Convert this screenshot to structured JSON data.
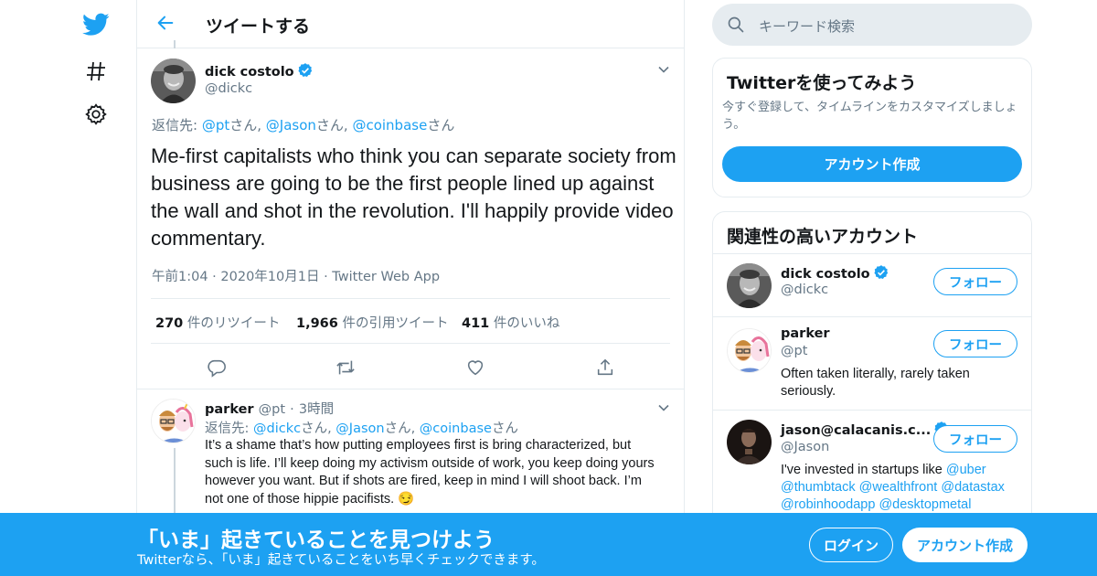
{
  "colors": {
    "accent": "#1da1f2",
    "border": "#e6ecf0",
    "secondary_text": "#657786",
    "primary_text": "#14171a"
  },
  "nav": {
    "icons": [
      "twitter-logo-icon",
      "hashtag-icon",
      "gear-icon"
    ]
  },
  "header": {
    "title": "ツイートする",
    "back_icon": "arrow-left-icon"
  },
  "tweet": {
    "author_name": "dick costolo",
    "author_handle": "@dickc",
    "verified": true,
    "reply_prefix": "返信先: ",
    "reply_to": [
      {
        "handle": "@pt",
        "suffix": "さん, "
      },
      {
        "handle": "@Jason",
        "suffix": "さん, "
      },
      {
        "handle": "@coinbase",
        "suffix": "さん"
      }
    ],
    "text": "Me-first capitalists who think you can separate society from business are going to be the first people lined up against the wall and shot in the revolution. I'll happily provide video commentary.",
    "time": "午前1:04",
    "date": "2020年10月1日",
    "source": "Twitter Web App",
    "dot": "·",
    "stats": {
      "retweets": "270",
      "retweets_label": "件のリツイート",
      "quotes": "1,966",
      "quotes_label": "件の引用ツイート",
      "likes": "411",
      "likes_label": "件のいいね"
    }
  },
  "reply": {
    "author_name": "parker",
    "author_handle": "@pt",
    "dot": "·",
    "age": "3時間",
    "reply_prefix": "返信先: ",
    "reply_to": [
      {
        "handle": "@dickc",
        "suffix": "さん, "
      },
      {
        "handle": "@Jason",
        "suffix": "さん, "
      },
      {
        "handle": "@coinbase",
        "suffix": "さん"
      }
    ],
    "text": "It’s a shame that’s how putting employees first is bring characterized, but such is life. I’ll keep doing my activism outside of work, you keep doing yours however you want. But if shots are fired, keep in mind I will shoot back. I’m not one of those hippie pacifists.",
    "emoji": "😏"
  },
  "search": {
    "placeholder": "キーワード検索"
  },
  "signup_card": {
    "title": "Twitterを使ってみよう",
    "description": "今すぐ登録して、タイムラインをカスタマイズしましょう。",
    "button": "アカウント作成"
  },
  "related": {
    "title": "関連性の高いアカウント",
    "follow_label": "フォロー",
    "accounts": [
      {
        "name": "dick costolo",
        "handle": "@dickc",
        "verified": true,
        "bio": ""
      },
      {
        "name": "parker",
        "handle": "@pt",
        "verified": false,
        "bio": "Often taken literally, rarely taken seriously."
      },
      {
        "name": "jason@calacanis.c...",
        "handle": "@Jason",
        "verified": true,
        "bio_prefix": "I've invested in startups like ",
        "bio_links": [
          "@uber",
          "@thumbtack",
          "@wealthfront",
          "@datastax",
          "@robinhoodapp",
          "@desktopmetal"
        ]
      }
    ]
  },
  "banner": {
    "title": "「いま」起きていることを見つけよう",
    "subtitle": "Twitterなら、「いま」起きていることをいち早くチェックできます。",
    "login": "ログイン",
    "signup": "アカウント作成"
  }
}
